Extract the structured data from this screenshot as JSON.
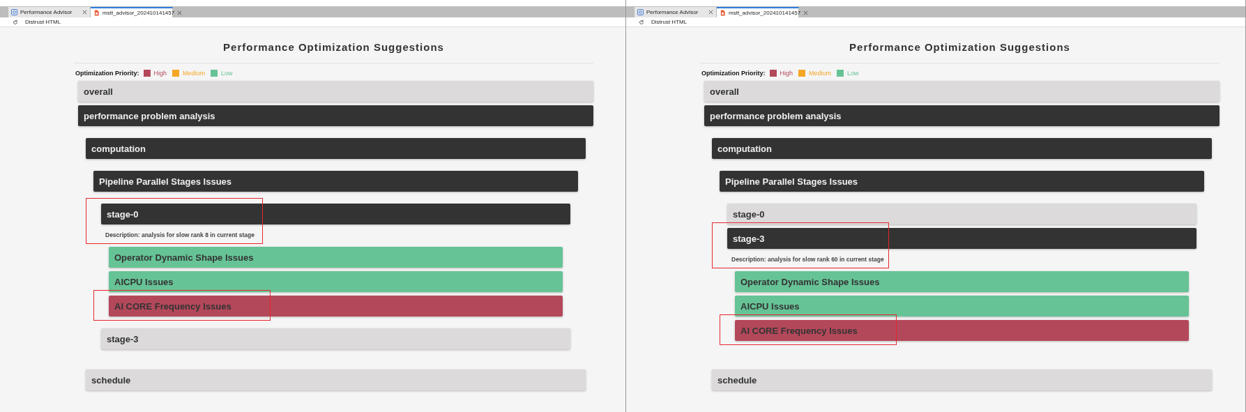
{
  "windows": [
    {
      "tabs": [
        {
          "label": "Performance Advisor",
          "selected": false,
          "kind": "app"
        },
        {
          "label": "mstt_advisor_202410141457",
          "selected": true,
          "kind": "file"
        }
      ],
      "toolbar": {
        "label": "Distrust HTML"
      },
      "page": {
        "title": "Performance Optimization Suggestions",
        "legend": {
          "label": "Optimization Priority:",
          "items": [
            {
              "label": "High",
              "color": "#b3485a"
            },
            {
              "label": "Medium",
              "color": "#f5a623"
            },
            {
              "label": "Low",
              "color": "#66c396"
            }
          ]
        },
        "nodes": [
          {
            "label": "overall",
            "expanded": false
          },
          {
            "label": "performance problem analysis",
            "expanded": true,
            "children": [
              {
                "label": "computation",
                "expanded": true,
                "children": [
                  {
                    "label": "Pipeline Parallel Stages Issues",
                    "expanded": true,
                    "children": [
                      {
                        "label": "stage-0",
                        "expanded": true,
                        "highlighted": true,
                        "description": "Description: analysis for slow rank 8 in current stage",
                        "children": [
                          {
                            "label": "Operator Dynamic Shape Issues",
                            "color": "#66c396"
                          },
                          {
                            "label": "AICPU Issues",
                            "color": "#66c396"
                          },
                          {
                            "label": "AI CORE Frequency Issues",
                            "color": "#b3485a",
                            "highlighted": true
                          }
                        ]
                      },
                      {
                        "label": "stage-3",
                        "expanded": false
                      }
                    ]
                  }
                ]
              },
              {
                "label": "schedule",
                "expanded": false
              }
            ]
          }
        ]
      }
    },
    {
      "tabs": [
        {
          "label": "Performance Advisor",
          "selected": false,
          "kind": "app"
        },
        {
          "label": "mstt_advisor_202410141457",
          "selected": true,
          "kind": "file"
        }
      ],
      "toolbar": {
        "label": "Distrust HTML"
      },
      "page": {
        "title": "Performance Optimization Suggestions",
        "legend": {
          "label": "Optimization Priority:",
          "items": [
            {
              "label": "High",
              "color": "#b3485a"
            },
            {
              "label": "Medium",
              "color": "#f5a623"
            },
            {
              "label": "Low",
              "color": "#66c396"
            }
          ]
        },
        "nodes": [
          {
            "label": "overall",
            "expanded": false
          },
          {
            "label": "performance problem analysis",
            "expanded": true,
            "children": [
              {
                "label": "computation",
                "expanded": true,
                "children": [
                  {
                    "label": "Pipeline Parallel Stages Issues",
                    "expanded": true,
                    "children": [
                      {
                        "label": "stage-0",
                        "expanded": false
                      },
                      {
                        "label": "stage-3",
                        "expanded": true,
                        "highlighted": true,
                        "description": "Description: analysis for slow rank 60 in current stage",
                        "children": [
                          {
                            "label": "Operator Dynamic Shape Issues",
                            "color": "#66c396"
                          },
                          {
                            "label": "AICPU Issues",
                            "color": "#66c396"
                          },
                          {
                            "label": "AI CORE Frequency Issues",
                            "color": "#b3485a",
                            "highlighted": true
                          }
                        ]
                      }
                    ]
                  }
                ]
              },
              {
                "label": "schedule",
                "expanded": false
              }
            ]
          }
        ]
      }
    }
  ]
}
